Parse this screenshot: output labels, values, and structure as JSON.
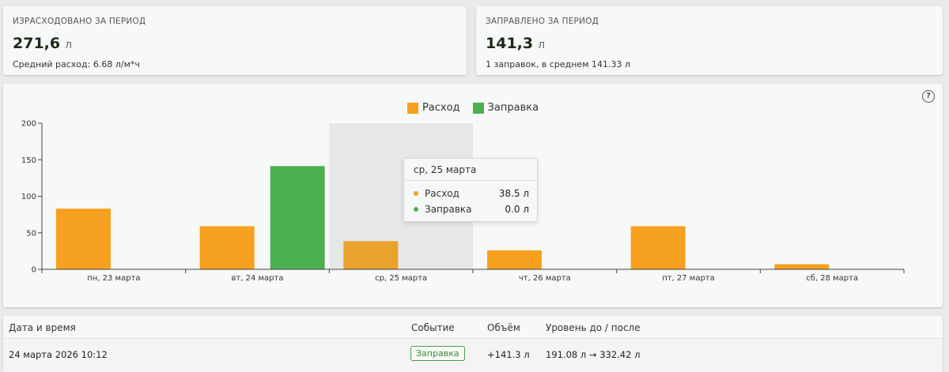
{
  "stats": {
    "consumed": {
      "label": "ИЗРАСХОДОВАНО ЗА ПЕРИОД",
      "value": "271,6",
      "unit": "л",
      "sub": "Средний расход: 6.68 л/м*ч"
    },
    "refueled": {
      "label": "ЗАПРАВЛЕНО ЗА ПЕРИОД",
      "value": "141,3",
      "unit": "л",
      "sub": "1 заправок, в среднем 141.33 л"
    }
  },
  "chart_data": {
    "type": "bar",
    "categories": [
      "пн, 23 марта",
      "вт, 24 марта",
      "ср, 25 марта",
      "чт, 26 марта",
      "пт, 27 марта",
      "сб, 28 марта"
    ],
    "series": [
      {
        "name": "Расход",
        "color": "#f5a11f",
        "values": [
          83,
          59,
          38.5,
          26,
          59,
          7
        ]
      },
      {
        "name": "Заправка",
        "color": "#4cb050",
        "values": [
          0,
          141.3,
          0,
          0,
          0,
          0
        ]
      }
    ],
    "ylim": [
      0,
      200
    ],
    "yticks": [
      "0",
      "50",
      "100",
      "150",
      "200"
    ],
    "legend": "top-center",
    "highlighted_category": "ср, 25 марта",
    "tooltip": {
      "title": "ср, 25 марта",
      "rows": [
        {
          "name": "Расход",
          "value": "38.5 л",
          "color": "#f5a11f"
        },
        {
          "name": "Заправка",
          "value": "0.0 л",
          "color": "#4cb050"
        }
      ]
    }
  },
  "table": {
    "headers": {
      "datetime": "Дата и время",
      "event": "Событие",
      "volume": "Объём",
      "level": "Уровень до / после"
    },
    "rows": [
      {
        "datetime": "24 марта 2026 10:12",
        "event": "Заправка",
        "volume": "+141.3 л",
        "level": "191.08 л → 332.42 л"
      }
    ]
  },
  "icons": {
    "help": "help-circle-icon"
  }
}
